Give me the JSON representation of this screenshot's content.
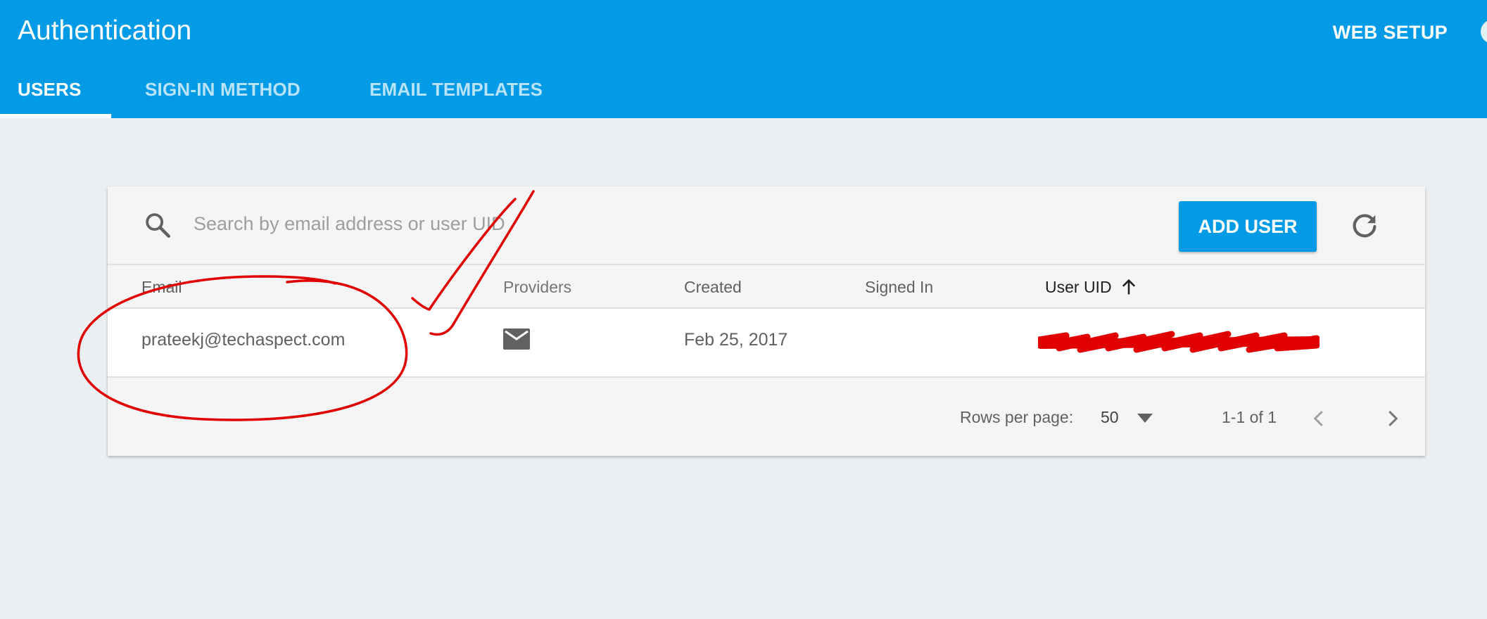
{
  "header": {
    "title": "Authentication",
    "web_setup": "WEB SETUP",
    "tabs": [
      {
        "label": "USERS",
        "active": true
      },
      {
        "label": "SIGN-IN METHOD",
        "active": false
      },
      {
        "label": "EMAIL TEMPLATES",
        "active": false
      }
    ]
  },
  "toolbar": {
    "search_icon": "search-icon",
    "search_placeholder": "Search by email address or user UID",
    "add_user_label": "ADD USER",
    "refresh_icon": "refresh-icon"
  },
  "table": {
    "columns": [
      "Email",
      "Providers",
      "Created",
      "Signed In",
      "User UID"
    ],
    "sorted_column": "User UID",
    "sort_icon": "arrow-up-icon",
    "rows": [
      {
        "email": "prateekj@techaspect.com",
        "provider_icon": "mail-icon",
        "created": "Feb 25, 2017",
        "signed_in": ""
      }
    ]
  },
  "pagination": {
    "rows_per_page_label": "Rows per page:",
    "rows_per_page": "50",
    "range": "1-1 of 1",
    "prev_icon": "chevron-left-icon",
    "next_icon": "chevron-right-icon"
  },
  "colors": {
    "brand": "#039be5",
    "background": "#eceff1",
    "annotation": "#e00000"
  }
}
